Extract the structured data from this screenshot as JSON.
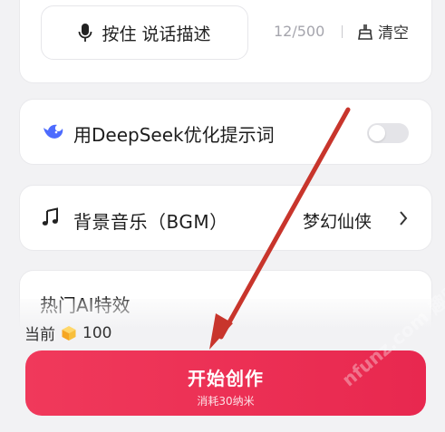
{
  "voice_card": {
    "hold_button_label": "按住 说话描述",
    "counter": "12/500",
    "clear_label": "清空"
  },
  "deepseek_card": {
    "label": "用DeepSeek优化提示词",
    "toggle_on": false
  },
  "bgm_card": {
    "label": "背景音乐（BGM）",
    "value": "梦幻仙侠"
  },
  "effects_card": {
    "label": "热门AI特效"
  },
  "balance": {
    "prefix": "当前",
    "amount": "100"
  },
  "cta": {
    "title": "开始创作",
    "subtitle": "消耗30纳米"
  },
  "watermark": "nfunz.com 趣网",
  "colors": {
    "accent": "#ed3457",
    "annotation_arrow": "#c8352c"
  }
}
